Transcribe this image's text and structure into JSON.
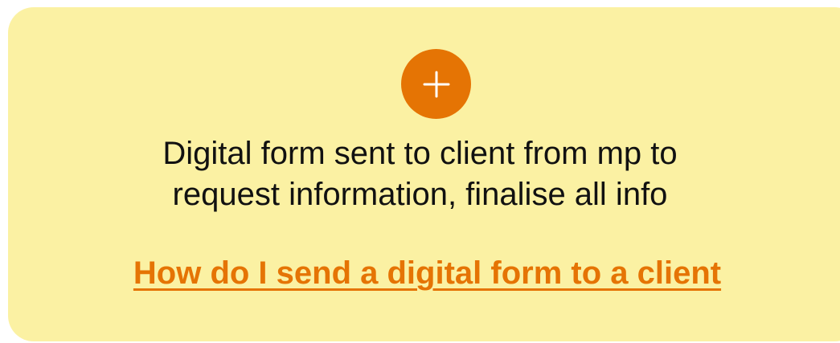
{
  "card": {
    "background": "#fbf1a3",
    "accent": "#e57404",
    "add_button": {
      "icon": "plus-icon"
    },
    "description": {
      "line1": "Digital form sent to client from mp to",
      "line2": "request information, finalise all info"
    },
    "help_link": {
      "label": "How do I send a digital form to a client"
    }
  }
}
